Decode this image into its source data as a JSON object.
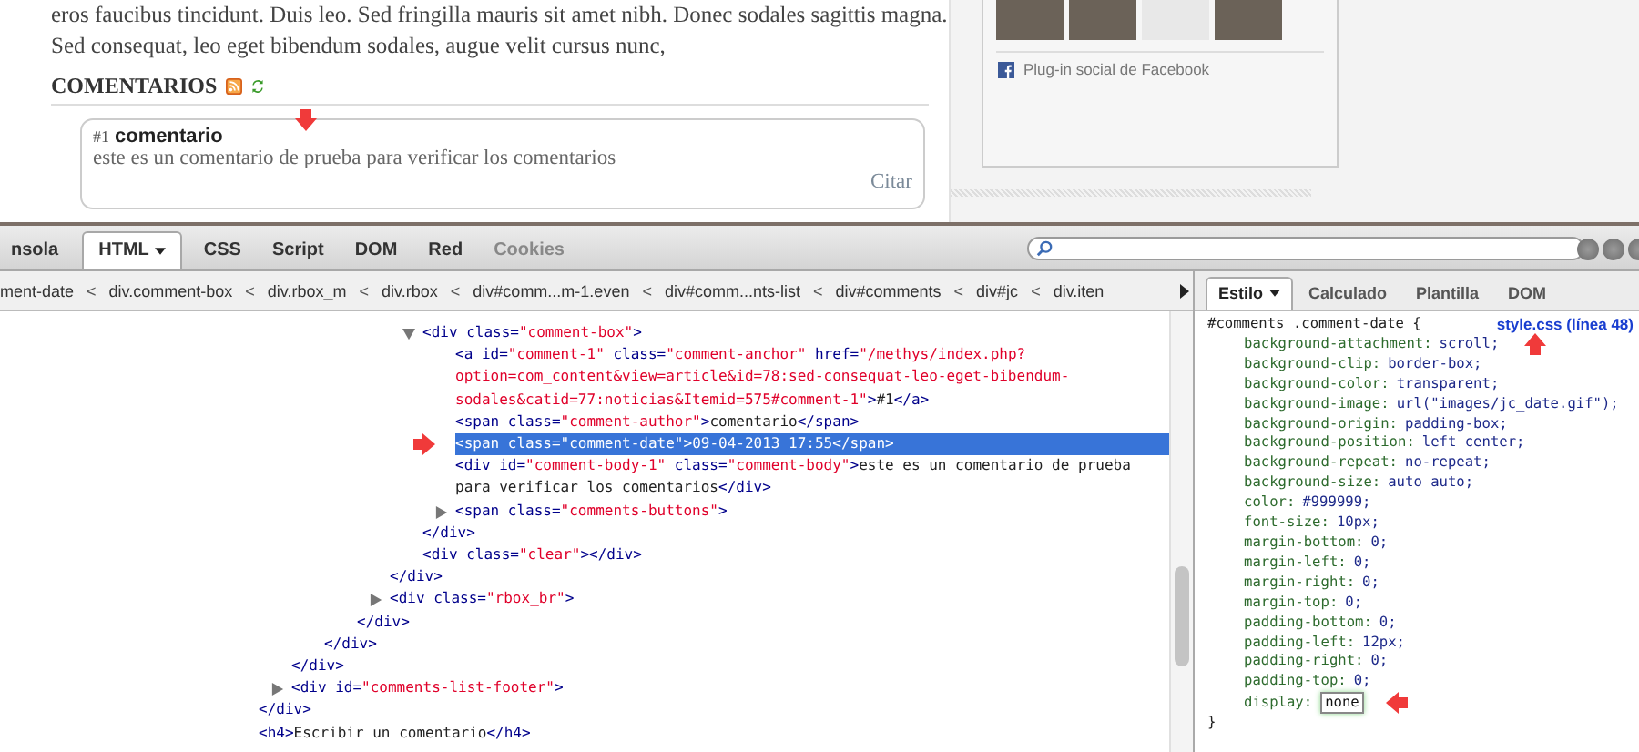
{
  "page": {
    "paragraph": "eros faucibus tincidunt. Duis leo. Sed fringilla mauris sit amet nibh. Donec sodales sagittis magna. Sed consequat, leo eget bibendum sodales, augue velit cursus nunc,",
    "comments_heading": "COMENTARIOS",
    "comment": {
      "number": "#1",
      "author": "comentario",
      "body": "este es un comentario de prueba para verificar los comentarios",
      "quote_link": "Citar"
    },
    "facebook": {
      "plugin_label": "Plug-in social de Facebook"
    }
  },
  "firebug": {
    "tabs": [
      {
        "label": "nsola",
        "selected": false,
        "dropdown": false,
        "disabled": false
      },
      {
        "label": "HTML",
        "selected": true,
        "dropdown": true,
        "disabled": false
      },
      {
        "label": "CSS",
        "selected": false,
        "dropdown": false,
        "disabled": false
      },
      {
        "label": "Script",
        "selected": false,
        "dropdown": false,
        "disabled": false
      },
      {
        "label": "DOM",
        "selected": false,
        "dropdown": false,
        "disabled": false
      },
      {
        "label": "Red",
        "selected": false,
        "dropdown": false,
        "disabled": false
      },
      {
        "label": "Cookies",
        "selected": false,
        "dropdown": false,
        "disabled": true
      }
    ],
    "breadcrumbs": [
      {
        "kind": "crumb",
        "label": "ment-date"
      },
      {
        "kind": "separator",
        "label": "<"
      },
      {
        "kind": "crumb",
        "label": "div.comment-box"
      },
      {
        "kind": "separator",
        "label": "<"
      },
      {
        "kind": "crumb",
        "label": "div.rbox_m"
      },
      {
        "kind": "separator",
        "label": "<"
      },
      {
        "kind": "crumb",
        "label": "div.rbox"
      },
      {
        "kind": "separator",
        "label": "<"
      },
      {
        "kind": "crumb",
        "label": "div#comm...m-1.even"
      },
      {
        "kind": "separator",
        "label": "<"
      },
      {
        "kind": "crumb",
        "label": "div#comm...nts-list"
      },
      {
        "kind": "separator",
        "label": "<"
      },
      {
        "kind": "crumb",
        "label": "div#comments"
      },
      {
        "kind": "separator",
        "label": "<"
      },
      {
        "kind": "crumb",
        "label": "div#jc"
      },
      {
        "kind": "separator",
        "label": "<"
      },
      {
        "kind": "crumb",
        "label": "div.iten"
      }
    ],
    "html_tree": [
      {
        "close": "</div>",
        "children": [
          {
            "close": "</div>",
            "children": [
              {
                "close": "</div>",
                "children": [
                  {
                    "close": "</div>",
                    "children": [
                      {
                        "close": "</div>",
                        "children": [
                          {
                            "open": "<div class=\"comment-box\">",
                            "close": "</div>",
                            "expanded": true,
                            "selected": false,
                            "children": [
                              {
                                "open": "<a id=\"comment-1\" class=\"comment-anchor\" href=\"/methys/index.php?option=com_content&view=article&id=78:sed-consequat-leo-eget-bibendum-sodales&catid=77:noticias&Itemid=575#comment-1\">#1</a>",
                                "selected": false
                              },
                              {
                                "open": "<span class=\"comment-author\">comentario</span>",
                                "selected": false
                              },
                              {
                                "open": "<span class=\"comment-date\">09-04-2013 17:55</span>",
                                "selected": true
                              },
                              {
                                "open": "<div id=\"comment-body-1\" class=\"comment-body\">este es un comentario de prueba para verificar los comentarios</div>",
                                "selected": false
                              },
                              {
                                "open": "<span class=\"comments-buttons\">",
                                "expanded": false,
                                "selected": false
                              }
                            ]
                          },
                          {
                            "open": "<div class=\"clear\"></div>",
                            "selected": false
                          }
                        ]
                      },
                      {
                        "open": "<div class=\"rbox_br\">",
                        "expanded": false,
                        "selected": false
                      }
                    ]
                  }
                ]
              }
            ]
          },
          {
            "open": "<div id=\"comments-list-footer\">",
            "expanded": false,
            "selected": false
          }
        ]
      },
      {
        "open": "<h4>Escribir un comentario</h4>",
        "selected": false
      }
    ],
    "side_tabs": [
      {
        "label": "Estilo",
        "selected": true,
        "dropdown": true
      },
      {
        "label": "Calculado",
        "selected": false,
        "dropdown": false
      },
      {
        "label": "Plantilla",
        "selected": false,
        "dropdown": false
      },
      {
        "label": "DOM",
        "selected": false,
        "dropdown": false
      }
    ],
    "css_rule": {
      "selector": "#comments .comment-date {",
      "source": "style.css (línea 48)",
      "close": "}",
      "properties": [
        {
          "name": "background-attachment:",
          "value": "scroll;",
          "editing": false
        },
        {
          "name": "background-clip:",
          "value": "border-box;",
          "editing": false
        },
        {
          "name": "background-color:",
          "value": "transparent;",
          "editing": false
        },
        {
          "name": "background-image:",
          "value": "url(\"images/jc_date.gif\");",
          "editing": false
        },
        {
          "name": "background-origin:",
          "value": "padding-box;",
          "editing": false
        },
        {
          "name": "background-position:",
          "value": "left center;",
          "editing": false
        },
        {
          "name": "background-repeat:",
          "value": "no-repeat;",
          "editing": false
        },
        {
          "name": "background-size:",
          "value": "auto auto;",
          "editing": false
        },
        {
          "name": "color:",
          "value": "#999999;",
          "editing": false
        },
        {
          "name": "font-size:",
          "value": "10px;",
          "editing": false
        },
        {
          "name": "margin-bottom:",
          "value": "0;",
          "editing": false
        },
        {
          "name": "margin-left:",
          "value": "0;",
          "editing": false
        },
        {
          "name": "margin-right:",
          "value": "0;",
          "editing": false
        },
        {
          "name": "margin-top:",
          "value": "0;",
          "editing": false
        },
        {
          "name": "padding-bottom:",
          "value": "0;",
          "editing": false
        },
        {
          "name": "padding-left:",
          "value": "12px;",
          "editing": false
        },
        {
          "name": "padding-right:",
          "value": "0;",
          "editing": false
        },
        {
          "name": "padding-top:",
          "value": "0;",
          "editing": false
        },
        {
          "name": "display:",
          "value": "none",
          "editing": true
        }
      ]
    }
  }
}
